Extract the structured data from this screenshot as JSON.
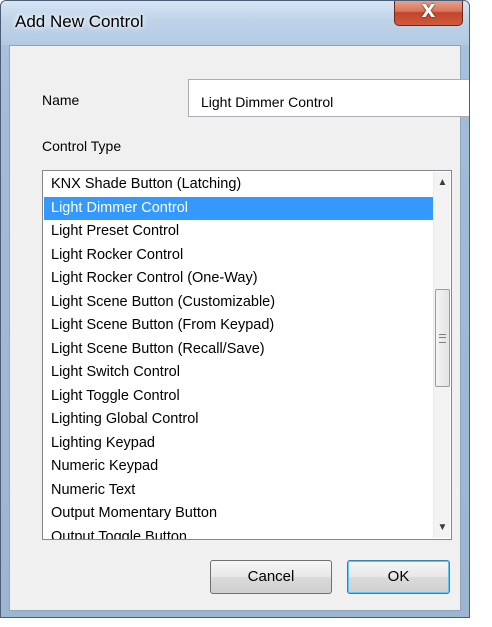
{
  "window": {
    "title": "Add New Control",
    "close_glyph": "X"
  },
  "form": {
    "name_label": "Name",
    "name_value": "Light Dimmer Control",
    "control_type_label": "Control Type"
  },
  "control_types": {
    "items": [
      "KNX Shade Button (Latching)",
      "Light Dimmer Control",
      "Light Preset Control",
      "Light Rocker Control",
      "Light Rocker Control (One-Way)",
      "Light Scene Button (Customizable)",
      "Light Scene Button (From Keypad)",
      "Light Scene Button (Recall/Save)",
      "Light Switch Control",
      "Light Toggle Control",
      "Lighting Global Control",
      "Lighting Keypad",
      "Numeric Keypad",
      "Numeric Text",
      "Output Momentary Button",
      "Output Toggle Button"
    ],
    "selected": "Light Dimmer Control"
  },
  "buttons": {
    "cancel": "Cancel",
    "ok": "OK"
  },
  "colors": {
    "selection": "#3399ff",
    "close_button": "#c3452a",
    "title_bar": "#b3cae3"
  }
}
